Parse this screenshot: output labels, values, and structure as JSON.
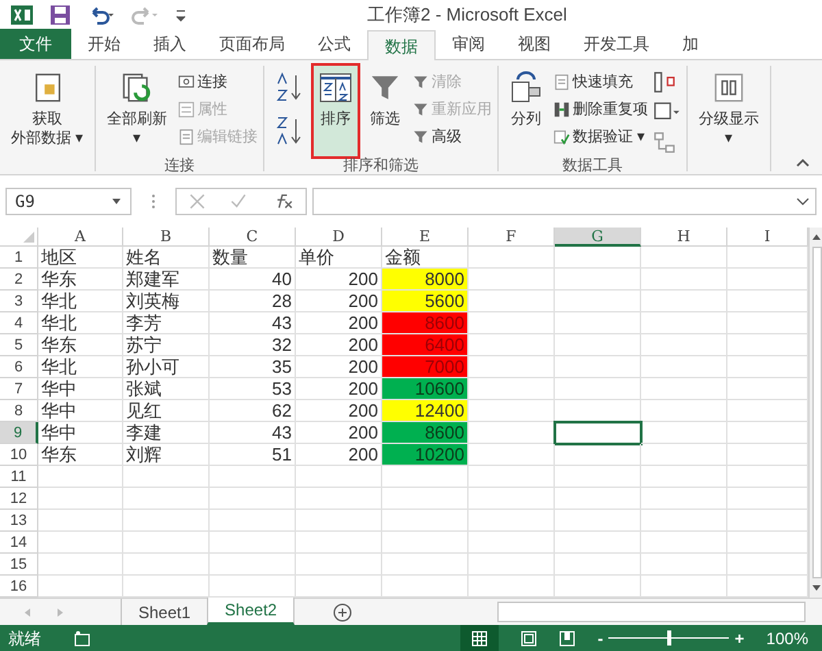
{
  "window": {
    "title": "工作簿2 - Microsoft Excel"
  },
  "tabs": [
    {
      "label": "文件",
      "kind": "file",
      "selected": false
    },
    {
      "label": "开始",
      "kind": "tab",
      "selected": false
    },
    {
      "label": "插入",
      "kind": "tab",
      "selected": false
    },
    {
      "label": "页面布局",
      "kind": "tab",
      "selected": false
    },
    {
      "label": "公式",
      "kind": "tab",
      "selected": false
    },
    {
      "label": "数据",
      "kind": "tab",
      "selected": true
    },
    {
      "label": "审阅",
      "kind": "tab",
      "selected": false
    },
    {
      "label": "视图",
      "kind": "tab",
      "selected": false
    },
    {
      "label": "开发工具",
      "kind": "tab",
      "selected": false
    },
    {
      "label": "加",
      "kind": "tab",
      "selected": false
    }
  ],
  "ribbon": [
    {
      "items": [
        {
          "kind": "large",
          "lines": [
            "获取",
            "外部数据 ▾"
          ],
          "selected": false
        }
      ]
    },
    {
      "label": "连接",
      "items": [
        {
          "kind": "large",
          "lines": [
            "全部刷新",
            "▾"
          ],
          "selected": false
        },
        {
          "kind": "small",
          "label": "连接",
          "disabled": false
        },
        {
          "kind": "small",
          "label": "属性",
          "disabled": true
        },
        {
          "kind": "small",
          "label": "编辑链接",
          "disabled": true
        }
      ]
    },
    {
      "label": "排序和筛选",
      "items": [
        {
          "kind": "sortpair"
        },
        {
          "kind": "large",
          "lines": [
            "排序"
          ],
          "selected": true
        },
        {
          "kind": "large",
          "lines": [
            "筛选"
          ],
          "selected": false
        },
        {
          "kind": "small",
          "label": "清除",
          "disabled": true
        },
        {
          "kind": "small",
          "label": "重新应用",
          "disabled": true
        },
        {
          "kind": "small",
          "label": "高级",
          "disabled": false
        }
      ]
    },
    {
      "label": "数据工具",
      "items": [
        {
          "kind": "large",
          "lines": [
            "分列"
          ],
          "selected": false
        },
        {
          "kind": "small",
          "label": "快速填充",
          "disabled": false
        },
        {
          "kind": "small",
          "label": "删除重复项",
          "disabled": false
        },
        {
          "kind": "small",
          "label": "数据验证 ▾",
          "disabled": false
        },
        {
          "kind": "iconcol"
        }
      ]
    },
    {
      "items": [
        {
          "kind": "large",
          "lines": [
            "分级显示",
            "▾"
          ],
          "selected": false
        }
      ]
    }
  ],
  "formula_bar": {
    "name_box": "G9"
  },
  "columns": [
    {
      "label": "A",
      "selected": false
    },
    {
      "label": "B",
      "selected": false
    },
    {
      "label": "C",
      "selected": false
    },
    {
      "label": "D",
      "selected": false
    },
    {
      "label": "E",
      "selected": false
    },
    {
      "label": "F",
      "selected": false
    },
    {
      "label": "G",
      "selected": true
    },
    {
      "label": "H",
      "selected": false
    },
    {
      "label": "I",
      "selected": false
    }
  ],
  "rows": [
    {
      "number": "1",
      "selected": false,
      "cells": [
        "地区",
        "姓名",
        "数量",
        "单价",
        "金额"
      ]
    },
    {
      "number": "2",
      "selected": false,
      "cells": [
        "华东",
        "郑建军",
        "40",
        "200",
        "8000"
      ],
      "color": "#ffff00"
    },
    {
      "number": "3",
      "selected": false,
      "cells": [
        "华北",
        "刘英梅",
        "28",
        "200",
        "5600"
      ],
      "color": "#ffff00"
    },
    {
      "number": "4",
      "selected": false,
      "cells": [
        "华北",
        "李芳",
        "43",
        "200",
        "8600"
      ],
      "color": "#ff0000"
    },
    {
      "number": "5",
      "selected": false,
      "cells": [
        "华东",
        "苏宁",
        "32",
        "200",
        "6400"
      ],
      "color": "#ff0000"
    },
    {
      "number": "6",
      "selected": false,
      "cells": [
        "华北",
        "孙小可",
        "35",
        "200",
        "7000"
      ],
      "color": "#ff0000"
    },
    {
      "number": "7",
      "selected": false,
      "cells": [
        "华中",
        "张斌",
        "53",
        "200",
        "10600"
      ],
      "color": "#00b050"
    },
    {
      "number": "8",
      "selected": false,
      "cells": [
        "华中",
        "见红",
        "62",
        "200",
        "12400"
      ],
      "color": "#ffff00"
    },
    {
      "number": "9",
      "selected": true,
      "cells": [
        "华中",
        "李建",
        "43",
        "200",
        "8600"
      ],
      "color": "#00b050"
    },
    {
      "number": "10",
      "selected": false,
      "cells": [
        "华东",
        "刘辉",
        "51",
        "200",
        "10200"
      ],
      "color": "#00b050"
    },
    {
      "number": "11",
      "selected": false,
      "cells": []
    },
    {
      "number": "12",
      "selected": false,
      "cells": []
    },
    {
      "number": "13",
      "selected": false,
      "cells": []
    },
    {
      "number": "14",
      "selected": false,
      "cells": []
    },
    {
      "number": "15",
      "selected": false,
      "cells": []
    },
    {
      "number": "16",
      "selected": false,
      "cells": []
    }
  ],
  "sheets": [
    {
      "label": "Sheet1",
      "selected": false
    },
    {
      "label": "Sheet2",
      "selected": true
    }
  ],
  "status_bar": {
    "status": "就绪",
    "zoom_out": "-",
    "zoom_in": "+",
    "zoom": "100%",
    "level": 0.5
  }
}
